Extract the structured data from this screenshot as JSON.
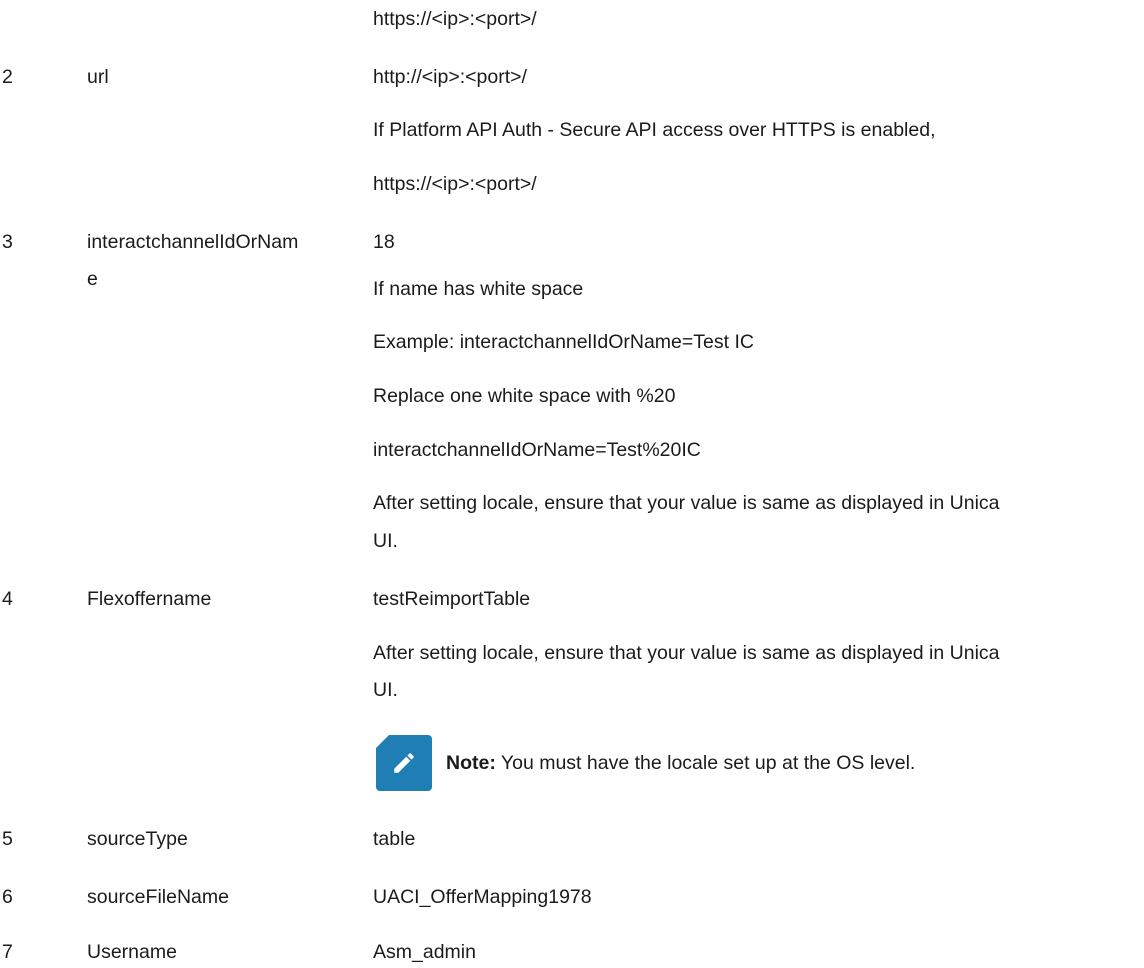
{
  "rows": [
    {
      "number": "",
      "parameter": "",
      "lines": [
        "https://<ip>:<port>/"
      ]
    },
    {
      "number": "2",
      "parameter": "url",
      "lines": [
        "http://<ip>:<port>/",
        "If Platform API Auth - Secure API access over HTTPS is enabled,",
        "https://<ip>:<port>/"
      ]
    },
    {
      "number": "3",
      "parameter_lines": [
        "interactchannelIdOrNam",
        "e"
      ],
      "lines": [
        "18",
        "If name has white space",
        "Example: interactchannelIdOrName=Test IC",
        "Replace one white space with %20",
        "interactchannelIdOrName=Test%20IC",
        "After setting locale, ensure that your value is same as displayed in Unica",
        "UI."
      ]
    },
    {
      "number": "4",
      "parameter": "Flexoffername",
      "lines": [
        "testReimportTable",
        "After setting locale, ensure that your value is same as displayed in Unica",
        "UI."
      ],
      "note": {
        "label": "Note:",
        "text": " You must have the locale set up at the OS level.",
        "icon": "pencil-icon",
        "icon_color": "#1f7fb5"
      }
    },
    {
      "number": "5",
      "parameter": "sourceType",
      "lines": [
        "table"
      ]
    },
    {
      "number": "6",
      "parameter": "sourceFileName",
      "lines": [
        "UACI_OfferMapping1978"
      ]
    },
    {
      "number": "7",
      "parameter": "Username",
      "lines": [
        "Asm_admin"
      ]
    }
  ]
}
